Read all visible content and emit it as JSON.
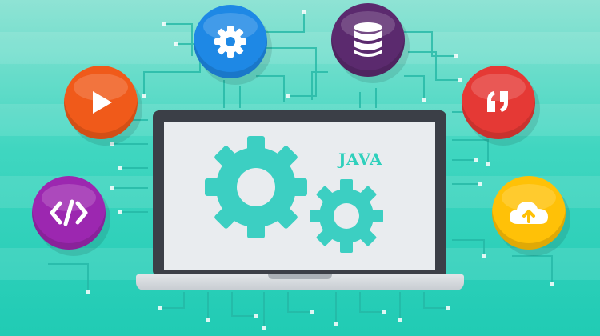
{
  "screen": {
    "label": "JAVA"
  },
  "icons": {
    "settings": "gear-icon",
    "database": "database-icon",
    "play": "play-icon",
    "quote": "quote-icon",
    "code": "code-icon",
    "cloud_upload": "cloud-upload-icon"
  },
  "colors": {
    "background": "#3fd6c0",
    "gear": "#3ccfc2",
    "java_text": "#2fd0bc",
    "bubble_blue": "#1e88e5",
    "bubble_purple": "#5b2a6e",
    "bubble_orange": "#f05a1a",
    "bubble_red": "#e53935",
    "bubble_violet": "#9c27b0",
    "bubble_yellow": "#ffc107"
  }
}
